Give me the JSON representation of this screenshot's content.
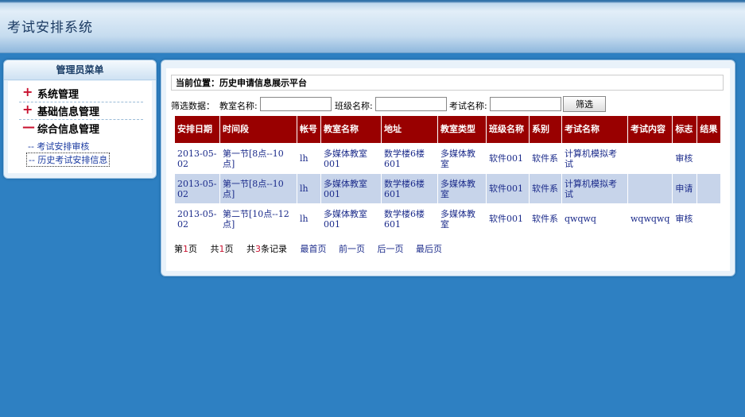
{
  "header": {
    "title": "考试安排系统"
  },
  "menu": {
    "title": "管理员菜单",
    "items": [
      {
        "sign": "+",
        "label": "系统管理"
      },
      {
        "sign": "+",
        "label": "基础信息管理"
      },
      {
        "sign": "—",
        "label": "综合信息管理"
      }
    ],
    "sublinks": [
      {
        "label": "-- 考试安排审核"
      },
      {
        "label": "-- 历史考试安排信息"
      }
    ]
  },
  "location": "当前位置：历史申请信息展示平台",
  "filter": {
    "prefix": "筛选数据：",
    "room_label": "教室名称:",
    "class_label": "班级名称:",
    "exam_label": "考试名称:",
    "room_value": "",
    "class_value": "",
    "exam_value": "",
    "button": "筛选"
  },
  "table": {
    "headers": [
      "安排日期",
      "时间段",
      "帐号",
      "教室名称",
      "地址",
      "教室类型",
      "班级名称",
      "系别",
      "考试名称",
      "考试内容",
      "标志",
      "结果"
    ],
    "rows": [
      [
        "2013-05-02",
        "第一节[8点--10点]",
        "lh",
        "多媒体教室001",
        "数学楼6楼601",
        "多媒体教室",
        "软件001",
        "软件系",
        "计算机模拟考试",
        "",
        "审核",
        ""
      ],
      [
        "2013-05-02",
        "第一节[8点--10点]",
        "lh",
        "多媒体教室001",
        "数学楼6楼601",
        "多媒体教室",
        "软件001",
        "软件系",
        "计算机模拟考试",
        "",
        "申请",
        ""
      ],
      [
        "2013-05-02",
        "第二节[10点--12点]",
        "lh",
        "多媒体教室001",
        "数学楼6楼601",
        "多媒体教室",
        "软件001",
        "软件系",
        "qwqwq",
        "wqwqwq",
        "审核",
        ""
      ]
    ]
  },
  "pager": {
    "page_prefix": "第",
    "page_num": "1",
    "page_suffix": "页",
    "total_prefix": "共",
    "total_num": "1",
    "total_suffix": "页",
    "records_prefix": "共",
    "records_num": "3",
    "records_suffix": "条记录",
    "first": "最首页",
    "prev": "前一页",
    "next": "后一页",
    "last": "最后页"
  }
}
